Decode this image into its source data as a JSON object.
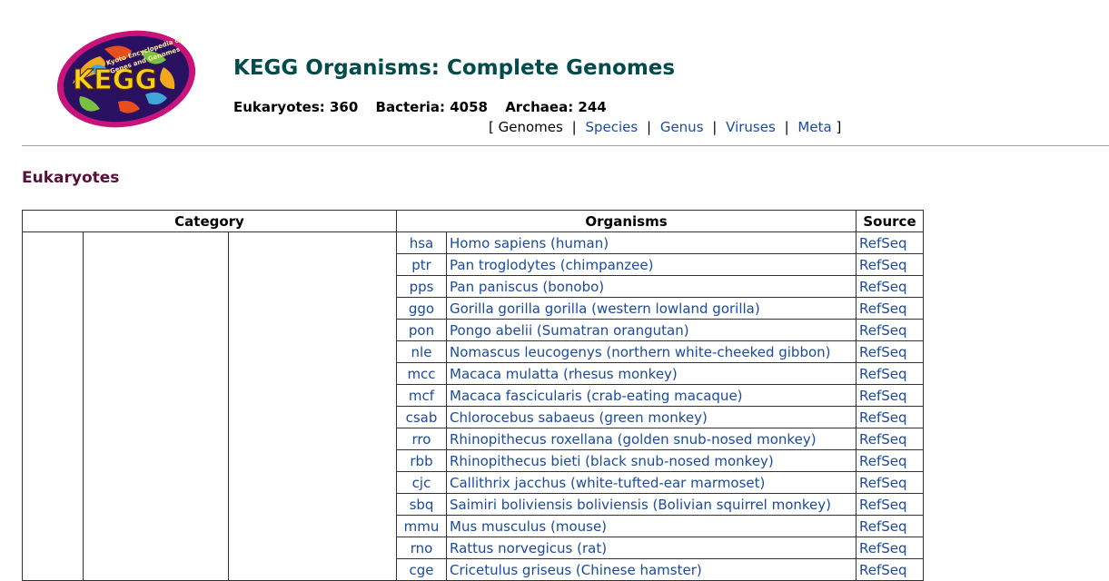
{
  "header": {
    "logo_text": "Kyoto Encyclopedia of Genes and Genomes",
    "logo_letters": "KEGG",
    "title": "KEGG Organisms: Complete Genomes",
    "counts": [
      {
        "label": "Eukaryotes: 360"
      },
      {
        "label": "Bacteria: 4058"
      },
      {
        "label": "Archaea: 244"
      }
    ],
    "nav": {
      "open": "[",
      "close": "]",
      "separator": "|",
      "items": [
        {
          "label": "Genomes"
        },
        {
          "label": "Species"
        },
        {
          "label": "Genus"
        },
        {
          "label": "Viruses"
        },
        {
          "label": "Meta"
        }
      ]
    }
  },
  "section_title": "Eukaryotes",
  "table": {
    "headers": {
      "category": "Category",
      "organisms": "Organisms",
      "source": "Source"
    },
    "rows": [
      {
        "code": "hsa",
        "name": "Homo sapiens (human)",
        "source": "RefSeq"
      },
      {
        "code": "ptr",
        "name": "Pan troglodytes (chimpanzee)",
        "source": "RefSeq"
      },
      {
        "code": "pps",
        "name": "Pan paniscus (bonobo)",
        "source": "RefSeq"
      },
      {
        "code": "ggo",
        "name": "Gorilla gorilla gorilla (western lowland gorilla)",
        "source": "RefSeq"
      },
      {
        "code": "pon",
        "name": "Pongo abelii (Sumatran orangutan)",
        "source": "RefSeq"
      },
      {
        "code": "nle",
        "name": "Nomascus leucogenys (northern white-cheeked gibbon)",
        "source": "RefSeq"
      },
      {
        "code": "mcc",
        "name": "Macaca mulatta (rhesus monkey)",
        "source": "RefSeq"
      },
      {
        "code": "mcf",
        "name": "Macaca fascicularis (crab-eating macaque)",
        "source": "RefSeq"
      },
      {
        "code": "csab",
        "name": "Chlorocebus sabaeus (green monkey)",
        "source": "RefSeq"
      },
      {
        "code": "rro",
        "name": "Rhinopithecus roxellana (golden snub-nosed monkey)",
        "source": "RefSeq"
      },
      {
        "code": "rbb",
        "name": "Rhinopithecus bieti (black snub-nosed monkey)",
        "source": "RefSeq"
      },
      {
        "code": "cjc",
        "name": "Callithrix jacchus (white-tufted-ear marmoset)",
        "source": "RefSeq"
      },
      {
        "code": "sbq",
        "name": "Saimiri boliviensis boliviensis (Bolivian squirrel monkey)",
        "source": "RefSeq"
      },
      {
        "code": "mmu",
        "name": "Mus musculus (mouse)",
        "source": "RefSeq"
      },
      {
        "code": "rno",
        "name": "Rattus norvegicus (rat)",
        "source": "RefSeq"
      },
      {
        "code": "cge",
        "name": "Cricetulus griseus (Chinese hamster)",
        "source": "RefSeq"
      }
    ]
  }
}
